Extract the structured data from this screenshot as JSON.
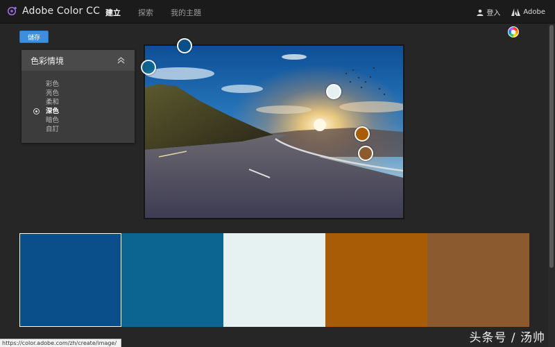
{
  "app": {
    "title": "Adobe Color CC"
  },
  "nav": {
    "items": [
      {
        "label": "建立",
        "active": true
      },
      {
        "label": "探索",
        "active": false
      },
      {
        "label": "我的主題",
        "active": false
      }
    ]
  },
  "header_right": {
    "login_label": "登入",
    "adobe_label": "Adobe"
  },
  "toolbar": {
    "save_label": "儲存"
  },
  "mood_panel": {
    "title": "色彩情境",
    "options": [
      "彩色",
      "亮色",
      "柔和",
      "深色",
      "暗色",
      "自訂"
    ],
    "selected": "深色"
  },
  "swatches": [
    {
      "color": "#0b4f8a",
      "selected": true
    },
    {
      "color": "#0c6590",
      "selected": false
    },
    {
      "color": "#e6f1f1",
      "selected": false
    },
    {
      "color": "#a85c06",
      "selected": false
    },
    {
      "color": "#8c5a2f",
      "selected": false
    }
  ],
  "pickers": [
    {
      "color": "#0b4f8a"
    },
    {
      "color": "#0c6590"
    },
    {
      "color": "#e6f1f1"
    },
    {
      "color": "#a85c06"
    },
    {
      "color": "#8c5a2f"
    }
  ],
  "status_bar": {
    "url": "https://color.adobe.com/zh/create/image/"
  },
  "watermark": {
    "text": "头条号 / 汤帅"
  }
}
